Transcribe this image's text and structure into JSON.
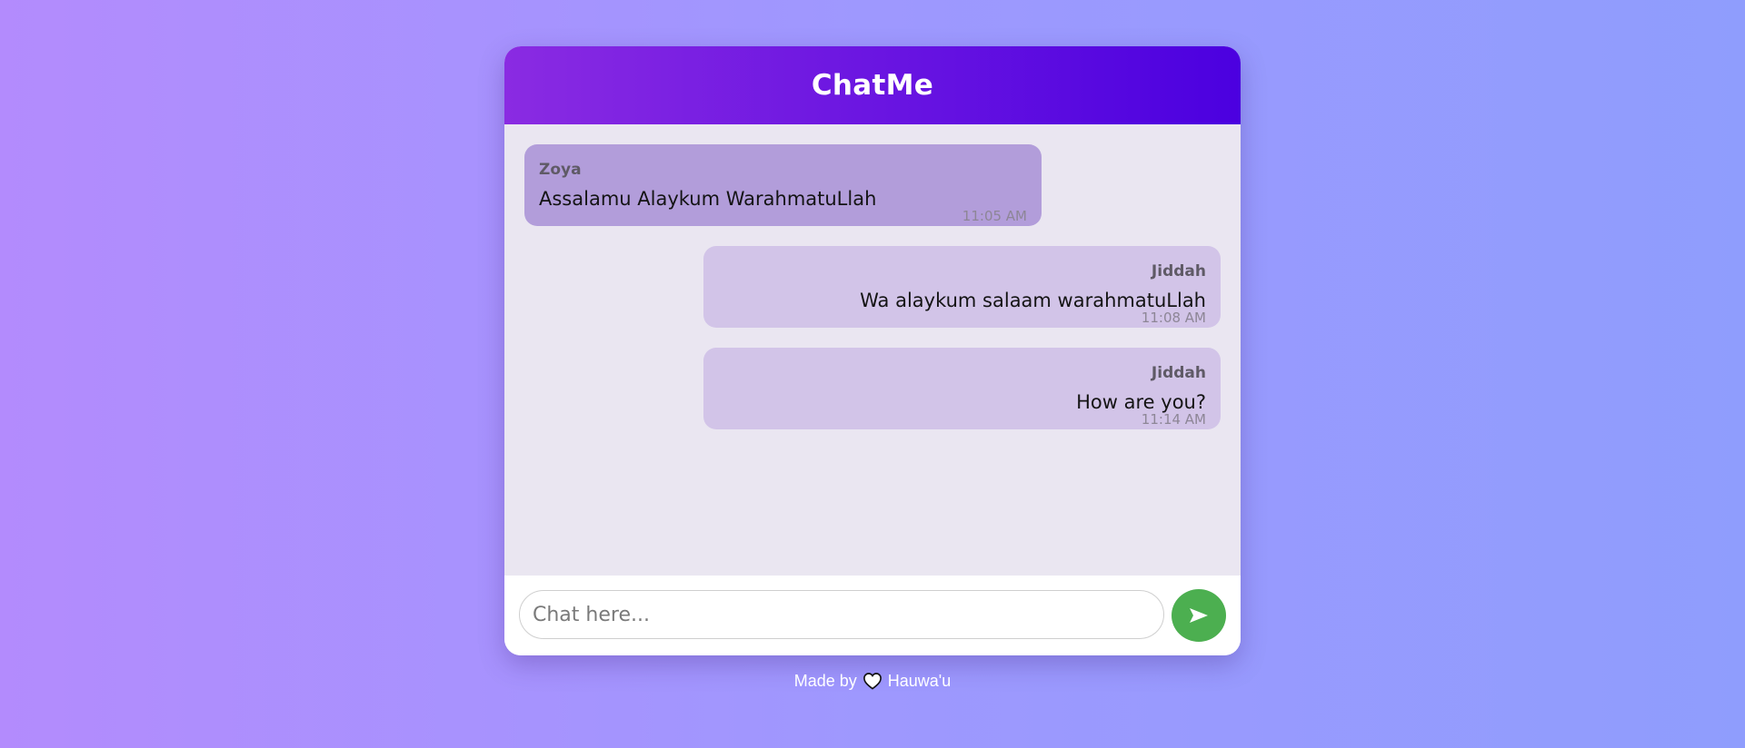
{
  "app": {
    "title": "ChatMe"
  },
  "messages": [
    {
      "sender": "Zoya",
      "text": "Assalamu Alaykum WarahmatuLlah",
      "time": "11:05 AM",
      "direction": "received"
    },
    {
      "sender": "Jiddah",
      "text": "Wa alaykum salaam warahmatuLlah",
      "time": "11:08 AM",
      "direction": "sent"
    },
    {
      "sender": "Jiddah",
      "text": "How are you?",
      "time": "11:14 AM",
      "direction": "sent"
    }
  ],
  "input": {
    "placeholder": "Chat here...",
    "value": ""
  },
  "send_button": {
    "icon": "send-arrow-icon",
    "color": "#4caf50"
  },
  "footer": {
    "made_by": "Made by",
    "heart_icon": "heart-icon",
    "author": "Hauwa'u"
  },
  "colors": {
    "header_start": "#8a2be2",
    "header_end": "#4b00e0",
    "received_bubble": "#b29dda",
    "sent_bubble": "#d2c4e8",
    "chat_background": "#eae6f1"
  }
}
